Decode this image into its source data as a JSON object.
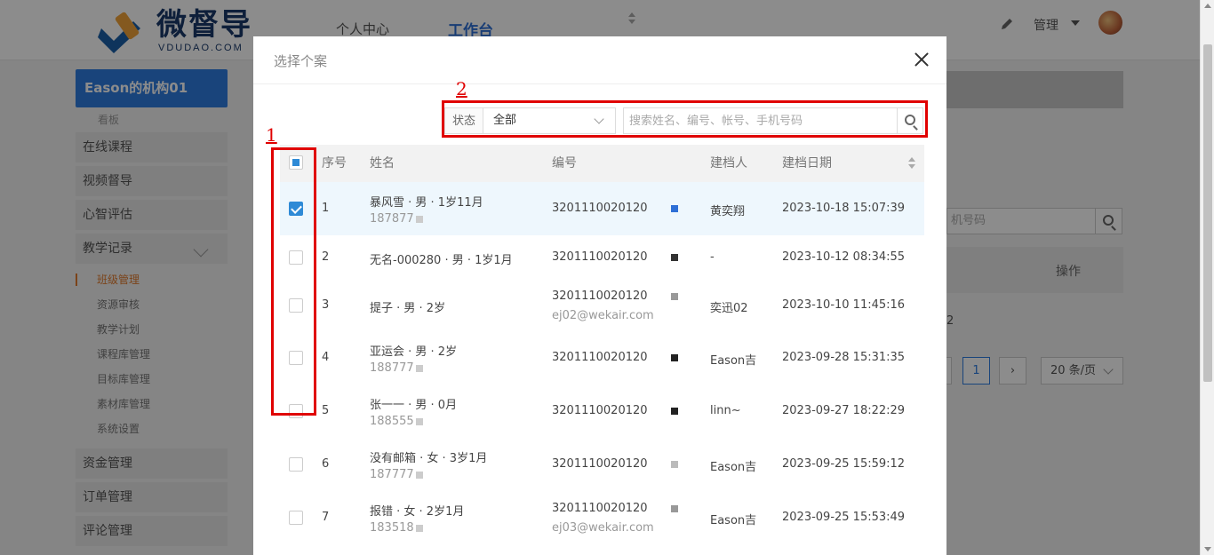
{
  "header": {
    "logo_text": "微督导",
    "logo_sub": "VDUDAO.COM",
    "nav": [
      "个人中心",
      "工作台"
    ],
    "user_menu": "管理"
  },
  "sidebar": {
    "org": "Eason的机构01",
    "sub": "看板",
    "items": [
      "在线课程",
      "视频督导",
      "心智评估",
      "教学记录"
    ],
    "children": [
      "班级管理",
      "资源审核",
      "教学计划",
      "课程库管理",
      "目标库管理",
      "素材库管理",
      "系统设置"
    ],
    "bottom": [
      "资金管理",
      "订单管理",
      "评论管理"
    ]
  },
  "background": {
    "search_placeholder": "机号码",
    "col_op": "操作",
    "count": "2",
    "page": "1",
    "page_size": "20 条/页"
  },
  "modal": {
    "title": "选择个案",
    "filter": {
      "label": "状态",
      "value": "全部",
      "placeholder": "搜索姓名、编号、帐号、手机号码"
    },
    "columns": {
      "no": "序号",
      "name": "姓名",
      "code": "编号",
      "creator": "建档人",
      "date": "建档日期"
    },
    "rows": [
      {
        "no": "1",
        "name": "暴风雪 · 男 · 1岁11月",
        "sub": "187877",
        "code": "3201110020120",
        "code_sub": "",
        "creator": "黄奕翔",
        "date": "2023-10-18 15:07:39",
        "checked": true
      },
      {
        "no": "2",
        "name": "无名-000280 · 男 · 1岁1月",
        "sub": "",
        "code": "3201110020120",
        "code_sub": "",
        "creator": "-",
        "date": "2023-10-12 08:34:55",
        "checked": false
      },
      {
        "no": "3",
        "name": "提子 · 男 · 2岁",
        "sub": "",
        "code": "3201110020120",
        "code_sub": "ej02@wekair.com",
        "creator": "奕迅02",
        "date": "2023-10-10 11:45:16",
        "checked": false
      },
      {
        "no": "4",
        "name": "亚运会 · 男 · 2岁",
        "sub": "188777",
        "code": "3201110020120",
        "code_sub": "",
        "creator": "Eason吉",
        "date": "2023-09-28 15:31:35",
        "checked": false
      },
      {
        "no": "5",
        "name": "张一一 · 男 · 0月",
        "sub": "188555",
        "code": "3201110020120",
        "code_sub": "",
        "creator": "linn~",
        "date": "2023-09-27 18:22:29",
        "checked": false
      },
      {
        "no": "6",
        "name": "没有邮箱 · 女 · 3岁1月",
        "sub": "187777",
        "code": "3201110020120",
        "code_sub": "",
        "creator": "Eason吉",
        "date": "2023-09-25 15:59:12",
        "checked": false
      },
      {
        "no": "7",
        "name": "报错 · 女 · 2岁1月",
        "sub": "183518",
        "code": "3201110020120",
        "code_sub": "ej03@wekair.com",
        "creator": "Eason吉",
        "date": "2023-09-25 15:53:49",
        "checked": false
      }
    ]
  },
  "annotations": [
    "1",
    "2"
  ],
  "colors": {
    "accent": "#2e7ce0",
    "annotation": "#e00000",
    "selected_row": "#eef7fd"
  }
}
